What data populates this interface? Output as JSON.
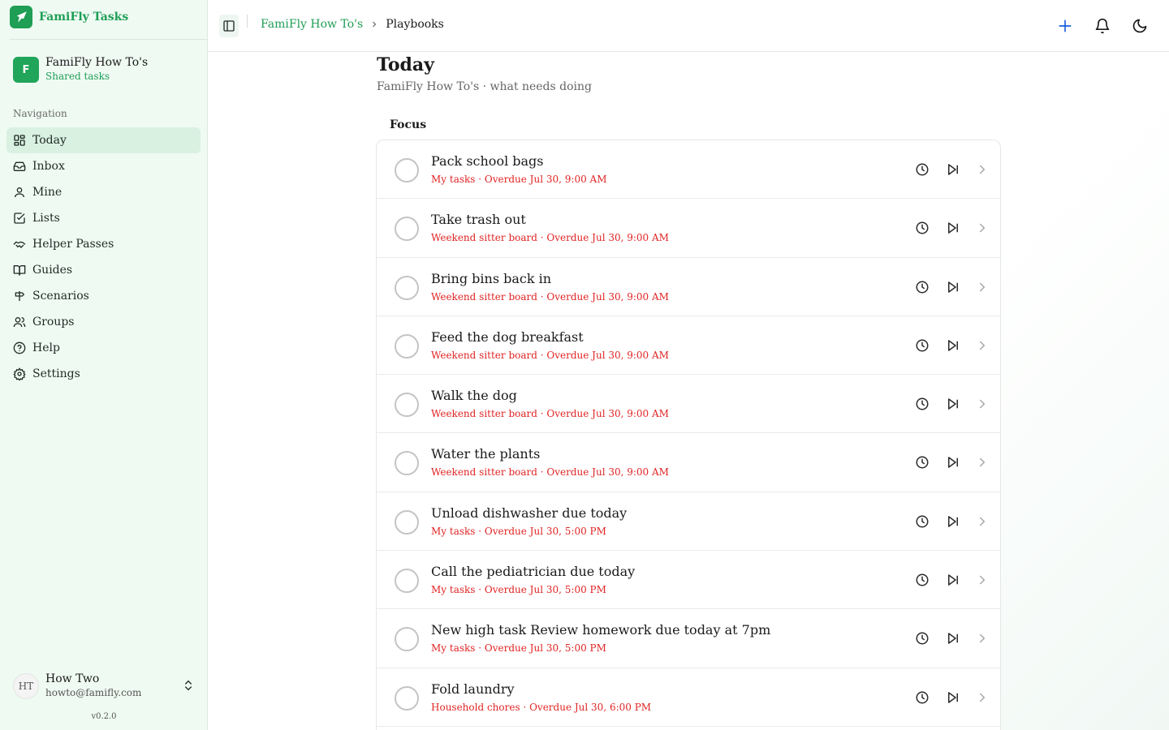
{
  "app": {
    "name": "FamiFly Tasks",
    "version": "v0.2.0",
    "brand_color": "#1f9e55",
    "overdue_color": "#e02424"
  },
  "workspace": {
    "initial": "F",
    "name": "FamiFly How To's",
    "subtitle": "Shared tasks"
  },
  "sidebar": {
    "section_title": "Navigation",
    "items": [
      {
        "label": "Today",
        "icon": "grid-icon"
      },
      {
        "label": "Inbox",
        "icon": "inbox-icon"
      },
      {
        "label": "Mine",
        "icon": "user-icon"
      },
      {
        "label": "Lists",
        "icon": "checkbox-icon"
      },
      {
        "label": "Helper Passes",
        "icon": "handshake-icon"
      },
      {
        "label": "Guides",
        "icon": "book-icon"
      },
      {
        "label": "Scenarios",
        "icon": "signpost-icon"
      },
      {
        "label": "Groups",
        "icon": "users-icon"
      },
      {
        "label": "Help",
        "icon": "help-circle-icon"
      },
      {
        "label": "Settings",
        "icon": "gear-icon"
      }
    ]
  },
  "user": {
    "initials": "HT",
    "name": "How Two",
    "email": "howto@famifly.com"
  },
  "header": {
    "breadcrumb": [
      "FamiFly How To's",
      "Playbooks"
    ]
  },
  "page": {
    "title": "Today",
    "subtitle": "FamiFly How To's · what needs doing",
    "section": "Focus"
  },
  "tasks": [
    {
      "title": "Pack school bags",
      "meta": "My tasks · Overdue Jul 30, 9:00 AM"
    },
    {
      "title": "Take trash out",
      "meta": "Weekend sitter board · Overdue Jul 30, 9:00 AM"
    },
    {
      "title": "Bring bins back in",
      "meta": "Weekend sitter board · Overdue Jul 30, 9:00 AM"
    },
    {
      "title": "Feed the dog breakfast",
      "meta": "Weekend sitter board · Overdue Jul 30, 9:00 AM"
    },
    {
      "title": "Walk the dog",
      "meta": "Weekend sitter board · Overdue Jul 30, 9:00 AM"
    },
    {
      "title": "Water the plants",
      "meta": "Weekend sitter board · Overdue Jul 30, 9:00 AM"
    },
    {
      "title": "Unload dishwasher due today",
      "meta": "My tasks · Overdue Jul 30, 5:00 PM"
    },
    {
      "title": "Call the pediatrician due today",
      "meta": "My tasks · Overdue Jul 30, 5:00 PM"
    },
    {
      "title": "New high task Review homework due today at 7pm",
      "meta": "My tasks · Overdue Jul 30, 5:00 PM"
    },
    {
      "title": "Fold laundry",
      "meta": "Household chores · Overdue Jul 30, 6:00 PM"
    }
  ]
}
